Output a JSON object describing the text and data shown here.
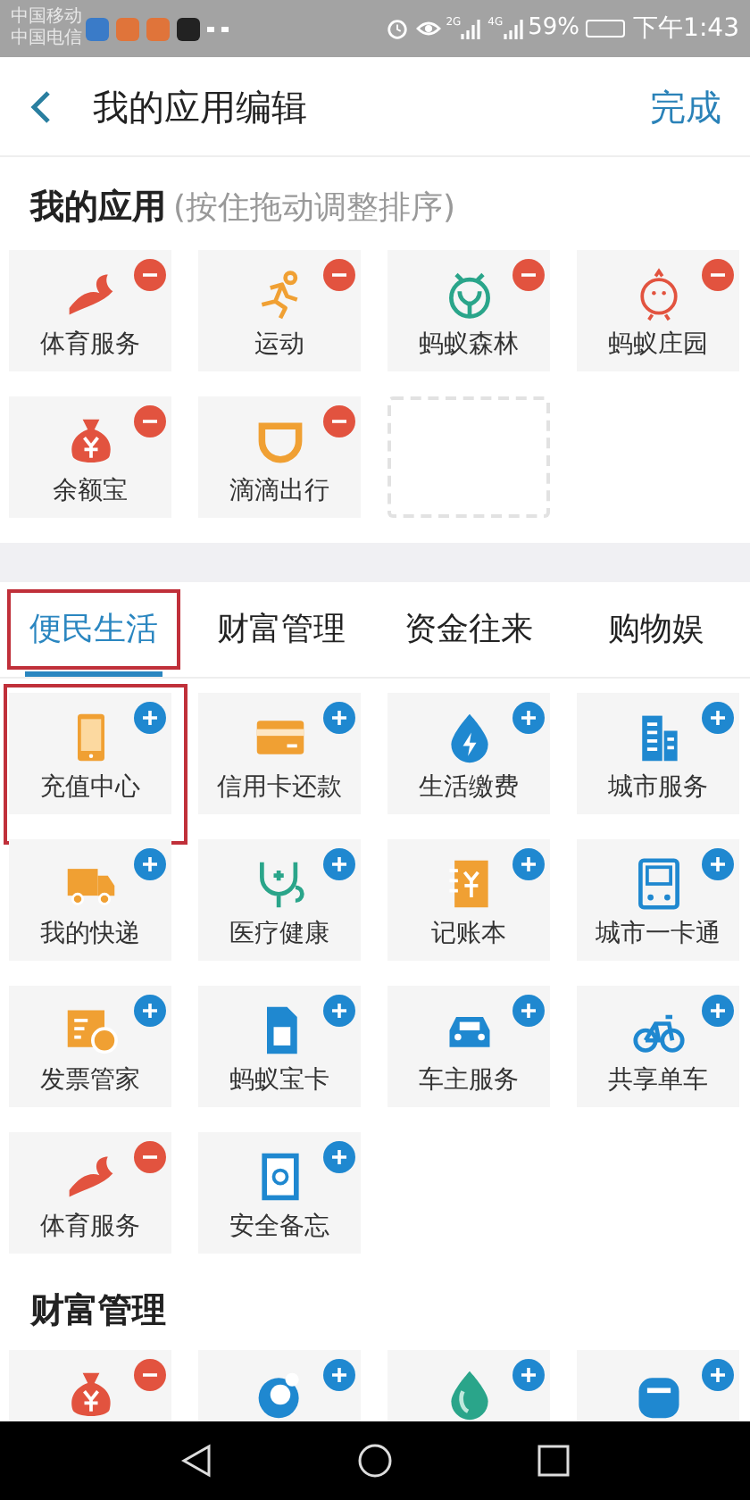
{
  "status_bar": {
    "carriers": [
      "中国移动",
      "中国电信"
    ],
    "network_labels": [
      "2G",
      "4G"
    ],
    "battery": "59%",
    "time": "下午1:43"
  },
  "header": {
    "title": "我的应用编辑",
    "done": "完成"
  },
  "my_apps": {
    "title": "我的应用",
    "hint": "(按住拖动调整排序)",
    "items": [
      {
        "label": "体育服务",
        "added": true
      },
      {
        "label": "运动",
        "added": true
      },
      {
        "label": "蚂蚁森林",
        "added": true
      },
      {
        "label": "蚂蚁庄园",
        "added": true
      },
      {
        "label": "余额宝",
        "added": true
      },
      {
        "label": "滴滴出行",
        "added": true
      }
    ]
  },
  "tabs": [
    {
      "label": "便民生活",
      "selected": true,
      "highlighted": true
    },
    {
      "label": "财富管理",
      "selected": false,
      "highlighted": false
    },
    {
      "label": "资金往来",
      "selected": false,
      "highlighted": false
    },
    {
      "label": "购物娱",
      "selected": false,
      "highlighted": false
    }
  ],
  "life_apps": {
    "items": [
      {
        "label": "充值中心",
        "added": false,
        "highlighted": true
      },
      {
        "label": "信用卡还款",
        "added": false
      },
      {
        "label": "生活缴费",
        "added": false
      },
      {
        "label": "城市服务",
        "added": false
      },
      {
        "label": "我的快递",
        "added": false
      },
      {
        "label": "医疗健康",
        "added": false
      },
      {
        "label": "记账本",
        "added": false
      },
      {
        "label": "城市一卡通",
        "added": false
      },
      {
        "label": "发票管家",
        "added": false
      },
      {
        "label": "蚂蚁宝卡",
        "added": false
      },
      {
        "label": "车主服务",
        "added": false
      },
      {
        "label": "共享单车",
        "added": false
      },
      {
        "label": "体育服务",
        "added": true
      },
      {
        "label": "安全备忘",
        "added": false
      }
    ]
  },
  "wealth": {
    "title": "财富管理",
    "items": [
      {
        "added": true
      },
      {
        "added": false
      },
      {
        "added": false
      },
      {
        "added": false
      }
    ]
  }
}
